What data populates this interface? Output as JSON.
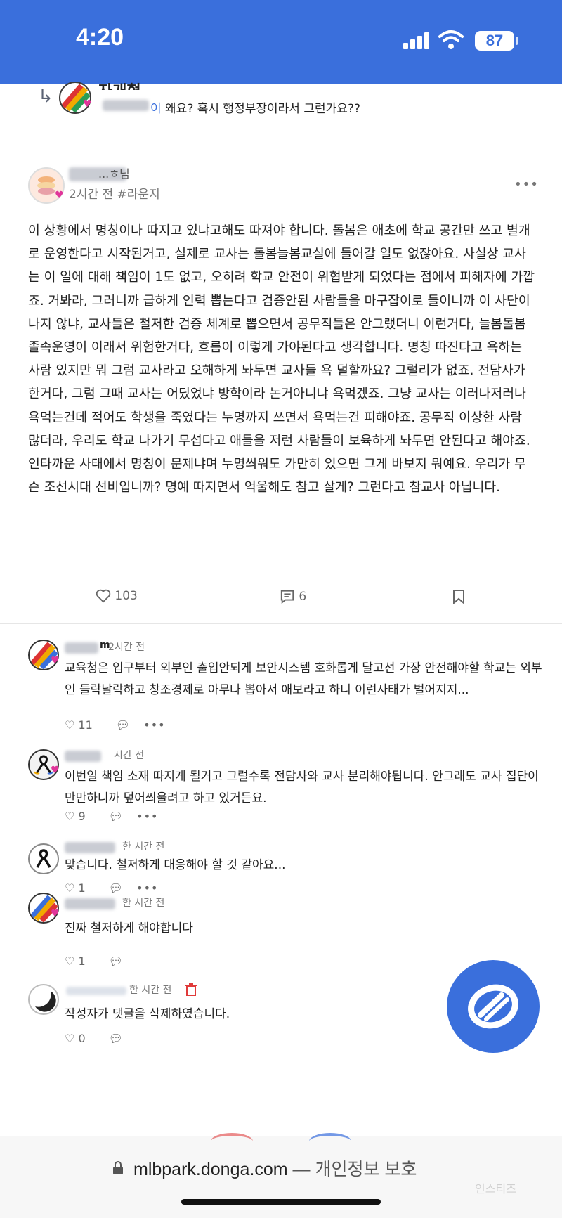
{
  "status_bar": {
    "time": "4:20",
    "battery": "87"
  },
  "reply_preview": {
    "name": "자개형",
    "mention": "이",
    "text": " 왜요? 혹시 행정부장이라서 그런가요??"
  },
  "post": {
    "author": "...ㅎ님",
    "meta": "2시간 전 #라운지",
    "more_label": "•••",
    "body": "이 상황에서 명칭이나 따지고 있냐고해도 따져야 합니다. 돌봄은 애초에 학교 공간만 쓰고 별개로 운영한다고 시작된거고, 실제로 교사는 돌봄늘봄교실에 들어갈 일도 없잖아요. 사실상 교사는 이 일에 대해 책임이 1도 없고, 오히려 학교 안전이 위협받게 되었다는 점에서 피해자에 가깝죠. 거봐라, 그러니까 급하게 인력 뽑는다고 검증안된 사람들을 마구잡이로 들이니까 이 사단이 나지 않냐, 교사들은 철저한 검증 체계로 뽑으면서 공무직들은 안그랬더니 이런거다, 늘봄돌봄 졸속운영이 이래서 위험한거다, 흐름이 이렇게 가야된다고 생각합니다. 명칭 따진다고 욕하는 사람 있지만 뭐 그럼 교사라고 오해하게 놔두면 교사들 욕 덜할까요? 그럴리가 없죠. 전담사가 한거다, 그럼 그때 교사는 어딨었냐 방학이라 논거아니냐 욕먹겠죠. 그냥 교사는 이러나저러나 욕먹는건데 적어도 학생을 죽였다는 누명까지 쓰면서 욕먹는건 피해야죠. 공무직 이상한 사람 많더라, 우리도 학교 나가기 무섭다고 애들을 저런 사람들이 보육하게 놔두면 안된다고 해야죠. 인타까운 사태에서 명칭이 문제냐며 누명씌워도 가만히 있으면 그게 바보지 뭐예요. 우리가 무슨 조선시대 선비입니까? 명예 따지면서 억울해도 참고 살게? 그런다고 참교사 아닙니다.",
    "likes": "103",
    "comments": "6"
  },
  "comments": [
    {
      "name_visible": "m",
      "time": "2시간 전",
      "text": "교육청은 입구부터 외부인 출입안되게 보안시스템 호화롭게 달고선 가장 안전해야할 학교는 외부인 들락날락하고 창조경제로 아무나 뽑아서 애보라고 하니 이런사태가 벌어지지...",
      "likes": "11",
      "avatar": "flag"
    },
    {
      "name_visible": "",
      "time": "시간 전",
      "text": "이번일 책임 소재 따지게 될거고 그럴수록 전담사와 교사 분리해야됩니다. 안그래도 교사 집단이 만만하니까 덮어씌울려고 하고 있거든요.",
      "likes": "9",
      "avatar": "ribbon-color"
    },
    {
      "name_visible": "",
      "time": "한 시간 전",
      "text": "맞습니다. 철저하게 대응해야 할 것 같아요...",
      "likes": "1",
      "avatar": "ribbon"
    },
    {
      "name_visible": "",
      "time": "한 시간 전",
      "text": "진짜 철저하게 해야합니다",
      "likes": "1",
      "avatar": "flag"
    },
    {
      "name_visible": "",
      "time": "한 시간 전",
      "text": "작성자가 댓글을 삭제하였습니다.",
      "likes": "0",
      "avatar": "moon"
    }
  ],
  "browser": {
    "domain": "mlbpark.donga.com",
    "suffix": " — 개인정보 보호"
  },
  "watermark": "인스티즈"
}
